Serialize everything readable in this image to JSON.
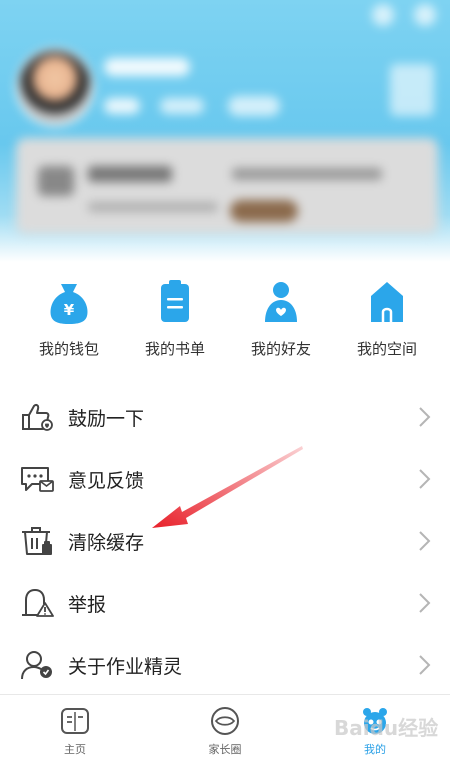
{
  "quick_actions": [
    {
      "label": "我的钱包",
      "icon": "wallet-icon"
    },
    {
      "label": "我的书单",
      "icon": "booklist-icon"
    },
    {
      "label": "我的好友",
      "icon": "friends-icon"
    },
    {
      "label": "我的空间",
      "icon": "space-icon"
    }
  ],
  "menu": [
    {
      "label": "鼓励一下",
      "icon": "thumbs-up-icon"
    },
    {
      "label": "意见反馈",
      "icon": "feedback-icon"
    },
    {
      "label": "清除缓存",
      "icon": "trash-icon"
    },
    {
      "label": "举报",
      "icon": "report-icon"
    },
    {
      "label": "关于作业精灵",
      "icon": "about-icon"
    }
  ],
  "bottom_nav": [
    {
      "label": "主页",
      "icon": "home-icon",
      "active": false
    },
    {
      "label": "家长圈",
      "icon": "parents-circle-icon",
      "active": false
    },
    {
      "label": "我的",
      "icon": "me-icon",
      "active": true
    }
  ],
  "watermark": "Baidu经验",
  "colors": {
    "accent": "#2aa0e6",
    "header": "#6ec9ef",
    "annotation_arrow": "#e8202a"
  }
}
